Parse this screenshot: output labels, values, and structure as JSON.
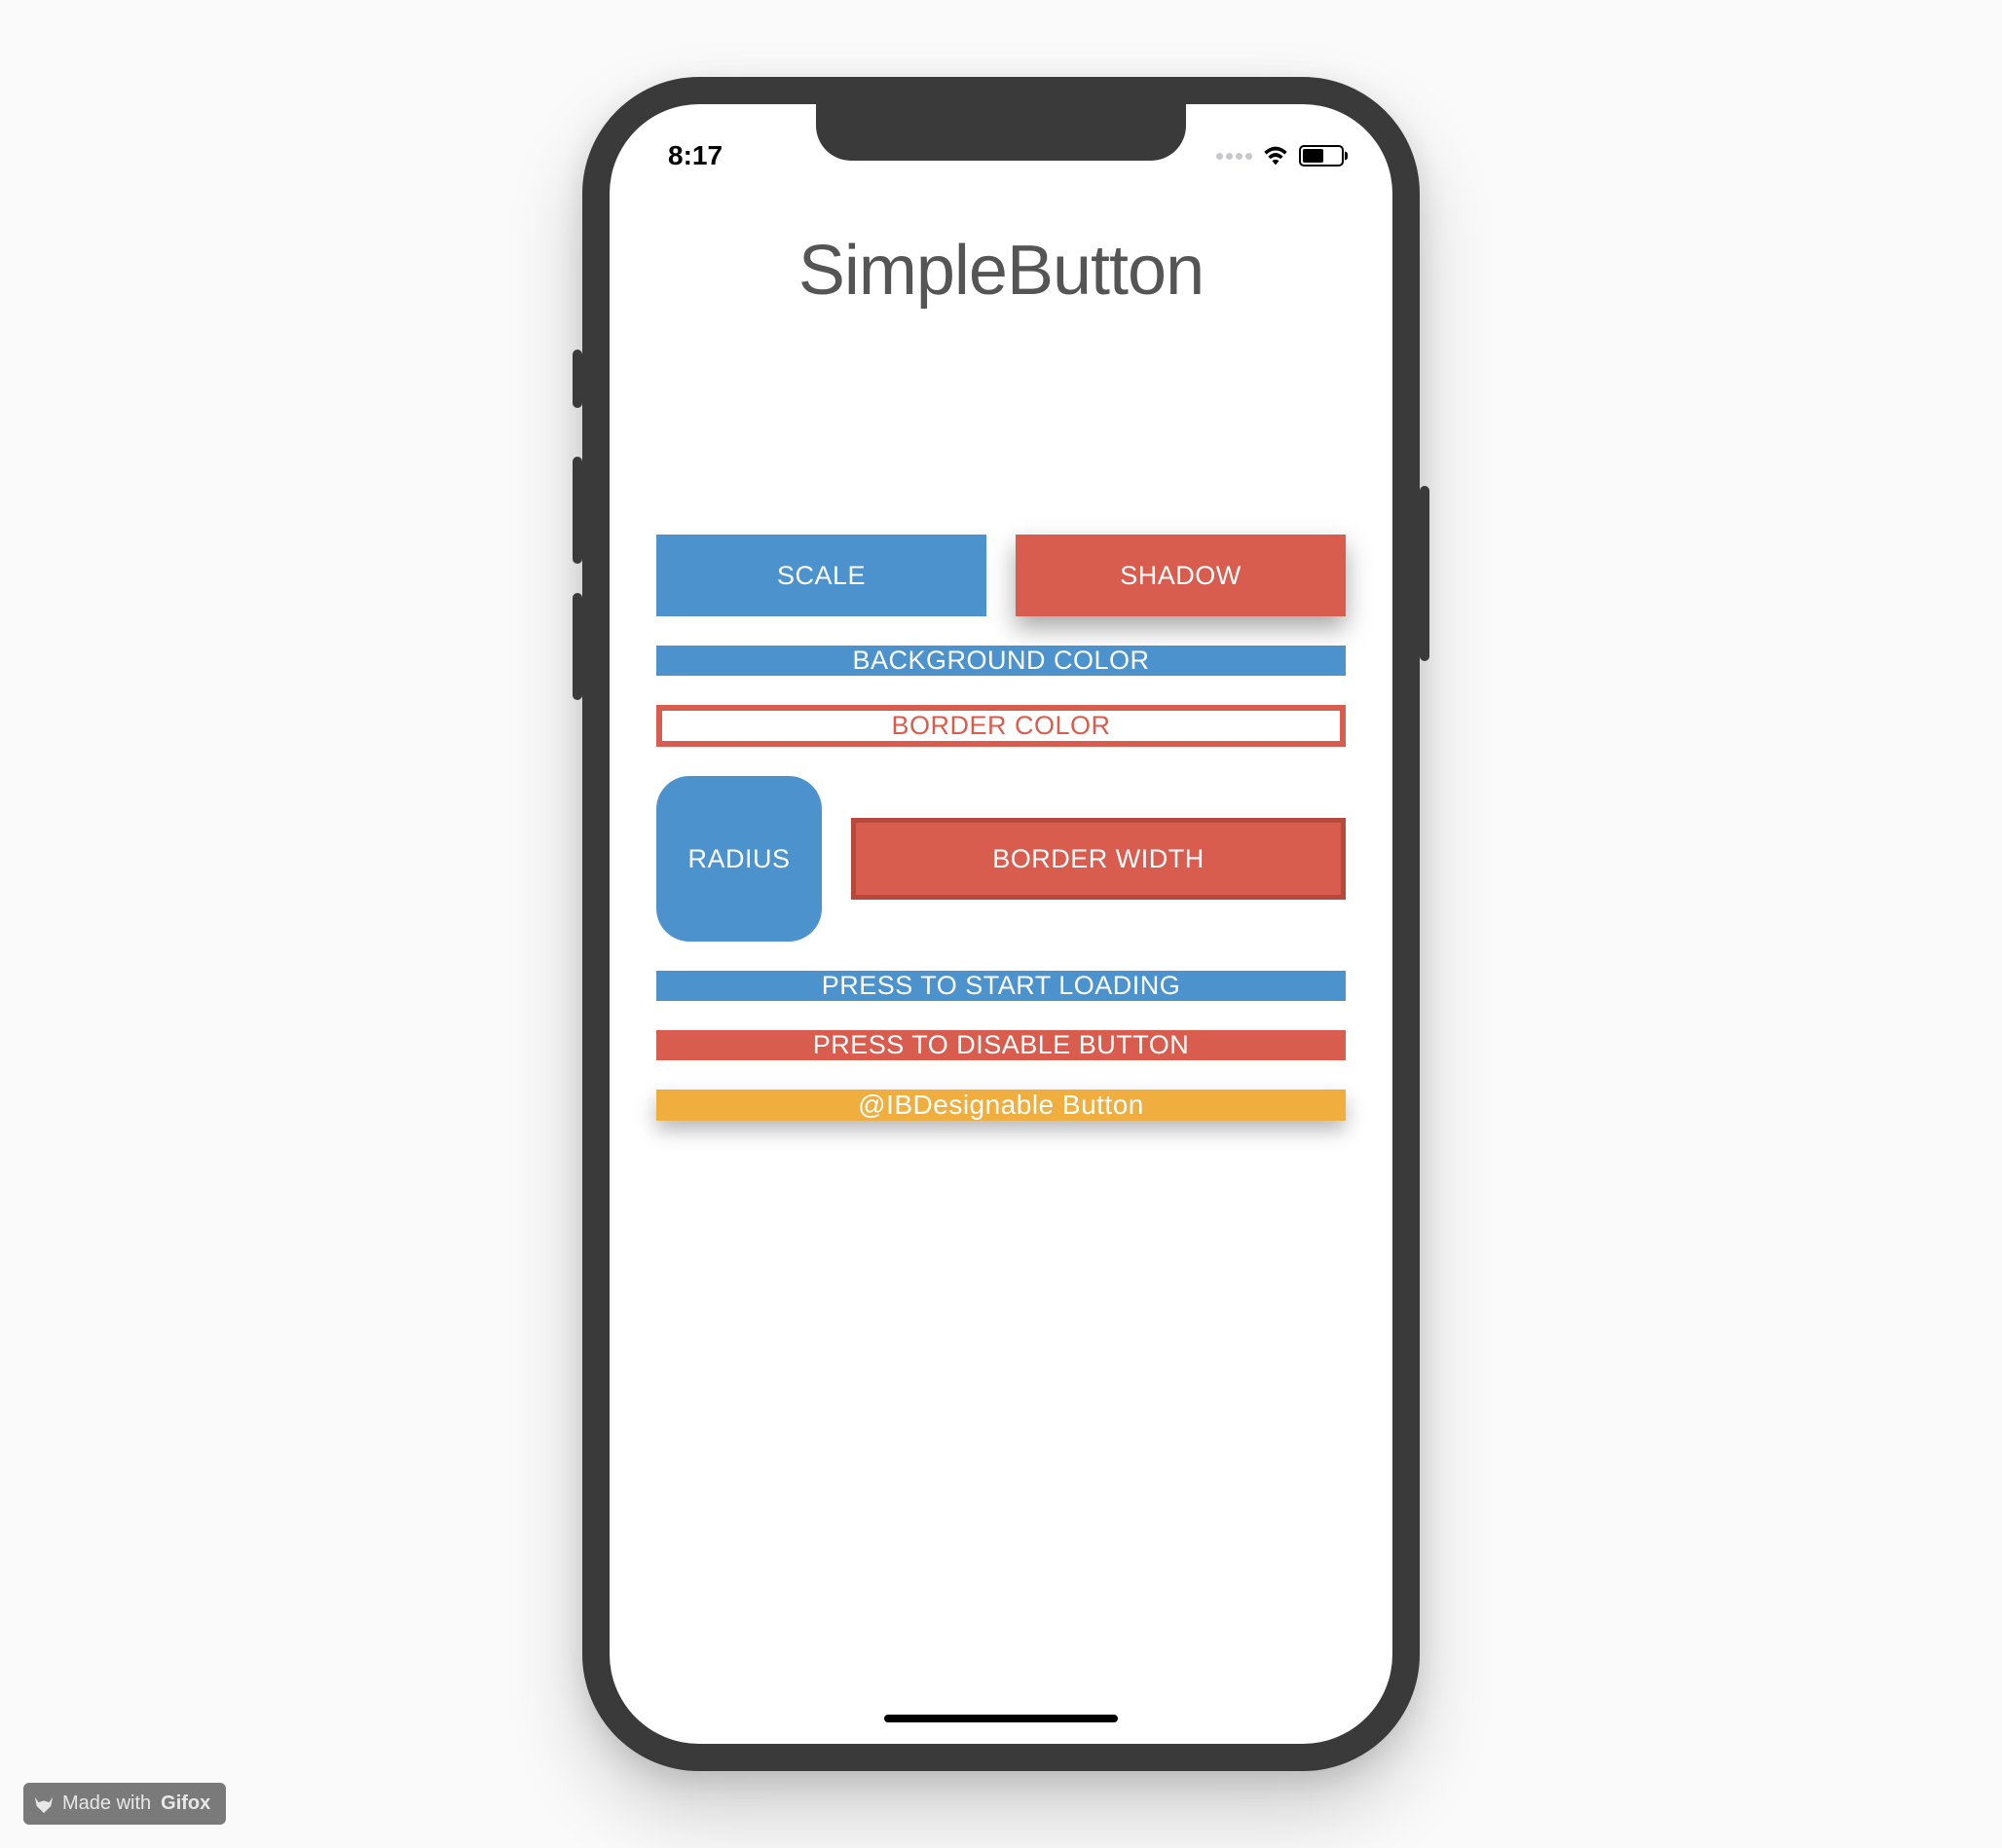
{
  "status": {
    "time": "8:17"
  },
  "app": {
    "title": "SimpleButton"
  },
  "buttons": {
    "scale": "SCALE",
    "shadow": "SHADOW",
    "background_color": "BACKGROUND COLOR",
    "border_color": "BORDER COLOR",
    "radius": "RADIUS",
    "border_width": "BORDER WIDTH",
    "loading": "PRESS TO START LOADING",
    "disable": "PRESS TO DISABLE BUTTON",
    "ibdesignable": "@IBDesignable Button"
  },
  "watermark": {
    "prefix": "Made with ",
    "brand": "Gifox"
  },
  "colors": {
    "blue": "#4c92cd",
    "red": "#d95d4e",
    "yellow": "#efae3d",
    "frame": "#3a3a3a"
  }
}
